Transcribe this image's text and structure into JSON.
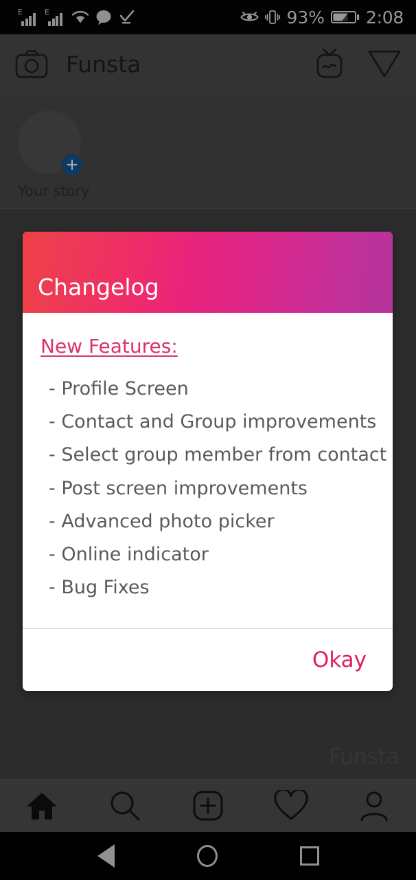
{
  "statusbar": {
    "signal1_type": "E",
    "signal2_type": "E",
    "battery_percent": "93%",
    "time": "2:08",
    "icons": [
      "signal-edge-icon",
      "signal-edge-icon",
      "wifi-icon",
      "message-bubble-icon",
      "checkmark-icon",
      "eye-icon",
      "vibrate-icon",
      "battery-icon"
    ]
  },
  "appbar": {
    "camera_icon": "camera-icon",
    "title": "Funsta",
    "igtv_icon": "igtv-icon",
    "send_icon": "send-icon"
  },
  "stories": {
    "your_story_label": "Your story",
    "add_badge": "+"
  },
  "watermark": {
    "text": "Funsta"
  },
  "dialog": {
    "title": "Changelog",
    "subtitle": "New Features:",
    "features": [
      "- Profile Screen",
      "- Contact and Group improvements",
      "- Select group member from contact",
      "- Post screen improvements",
      "- Advanced photo picker",
      "- Online indicator",
      "- Bug Fixes"
    ],
    "okay_label": "Okay",
    "gradient_start": "#ef3e44",
    "gradient_end": "#b4339d",
    "accent_color": "#d6356a",
    "okay_color": "#e01f5c"
  },
  "bottomnav": {
    "items": [
      {
        "name": "home-icon",
        "active": true
      },
      {
        "name": "search-icon",
        "active": false
      },
      {
        "name": "add-post-icon",
        "active": false
      },
      {
        "name": "heart-icon",
        "active": false
      },
      {
        "name": "profile-icon",
        "active": false
      }
    ]
  },
  "androidnav": {
    "back": "back-icon",
    "home": "home-circle-icon",
    "recents": "recents-square-icon"
  }
}
